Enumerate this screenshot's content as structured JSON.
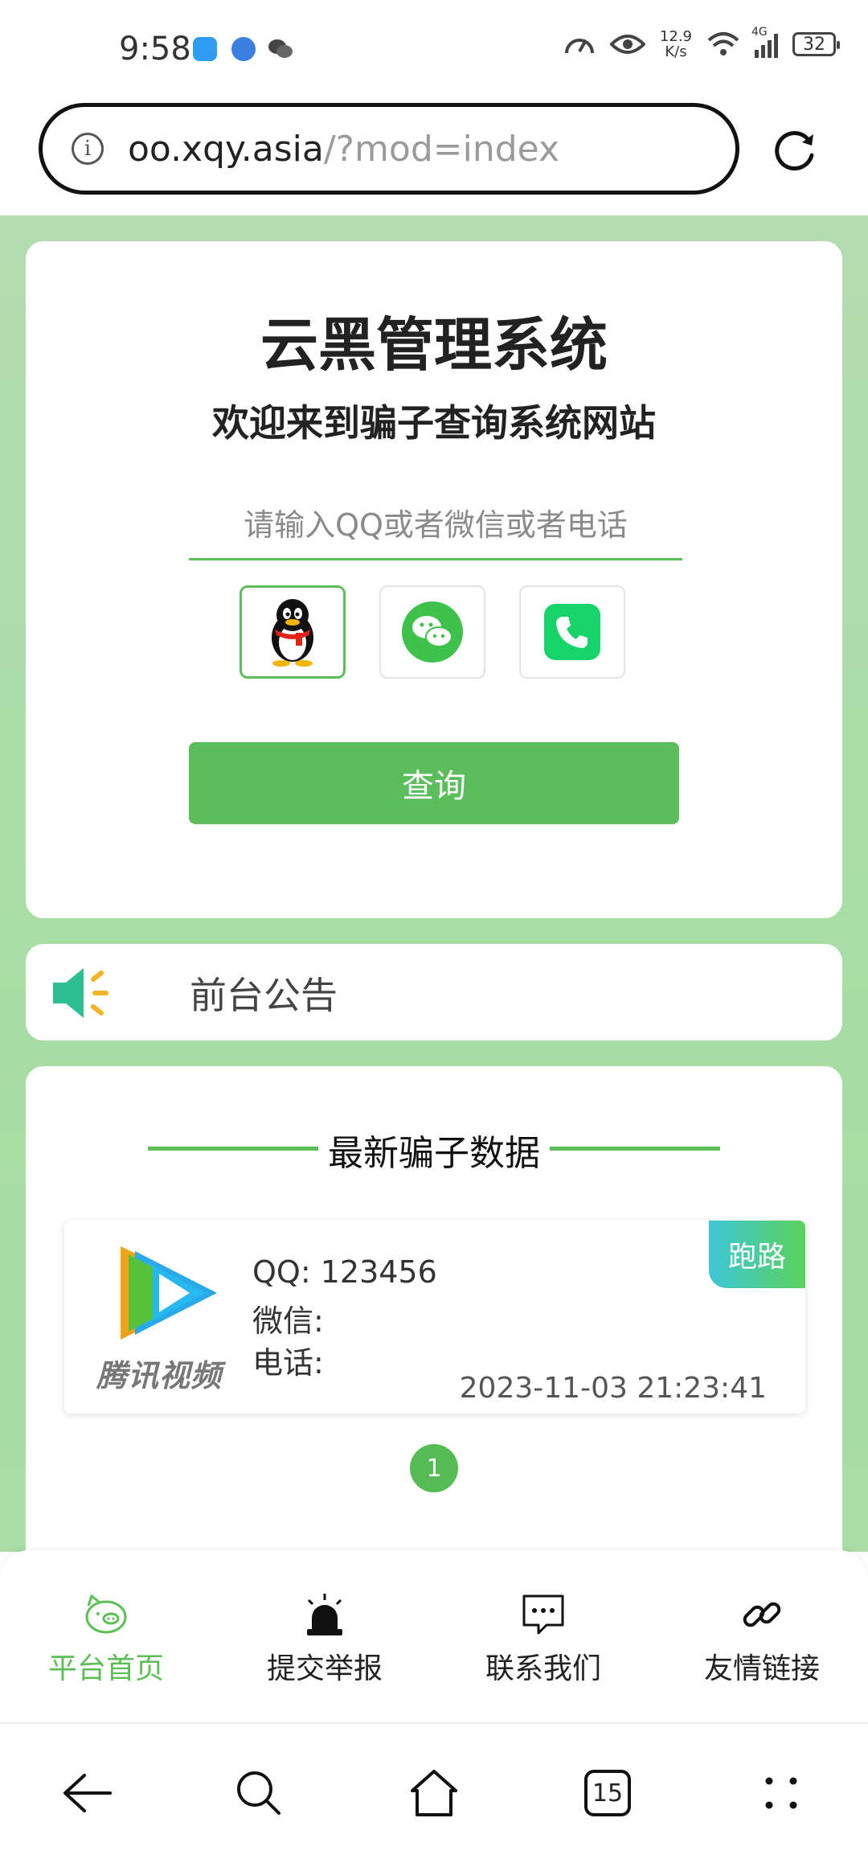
{
  "status_bar": {
    "time": "9:58",
    "net_speed_value": "12.9",
    "net_speed_unit": "K/s",
    "network": "4G",
    "battery": "32"
  },
  "browser": {
    "url_host": "oo.xqy.asia",
    "url_path": "/?mod=index",
    "tab_count": "15"
  },
  "hero": {
    "title": "云黑管理系统",
    "subtitle": "欢迎来到骗子查询系统网站",
    "search_placeholder": "请输入QQ或者微信或者电话",
    "types": [
      "QQ",
      "微信",
      "电话"
    ],
    "selected_type": "QQ",
    "query_label": "查询"
  },
  "notice": {
    "label": "前台公告"
  },
  "latest": {
    "section_title": "最新骗子数据",
    "entries": [
      {
        "logo_text": "腾讯视频",
        "qq_label": "QQ:",
        "qq": "123456",
        "wechat_label": "微信:",
        "wechat": "",
        "phone_label": "电话:",
        "phone": "",
        "time": "2023-11-03 21:23:41",
        "badge": "跑路"
      }
    ],
    "current_page": "1"
  },
  "tabbar": {
    "items": [
      {
        "label": "平台首页",
        "icon": "home-pig-icon",
        "active": true
      },
      {
        "label": "提交举报",
        "icon": "alarm-icon",
        "active": false
      },
      {
        "label": "联系我们",
        "icon": "message-icon",
        "active": false
      },
      {
        "label": "友情链接",
        "icon": "link-icon",
        "active": false
      }
    ]
  },
  "colors": {
    "accent": "#5bbf55",
    "page_bg": "#aadca7"
  }
}
